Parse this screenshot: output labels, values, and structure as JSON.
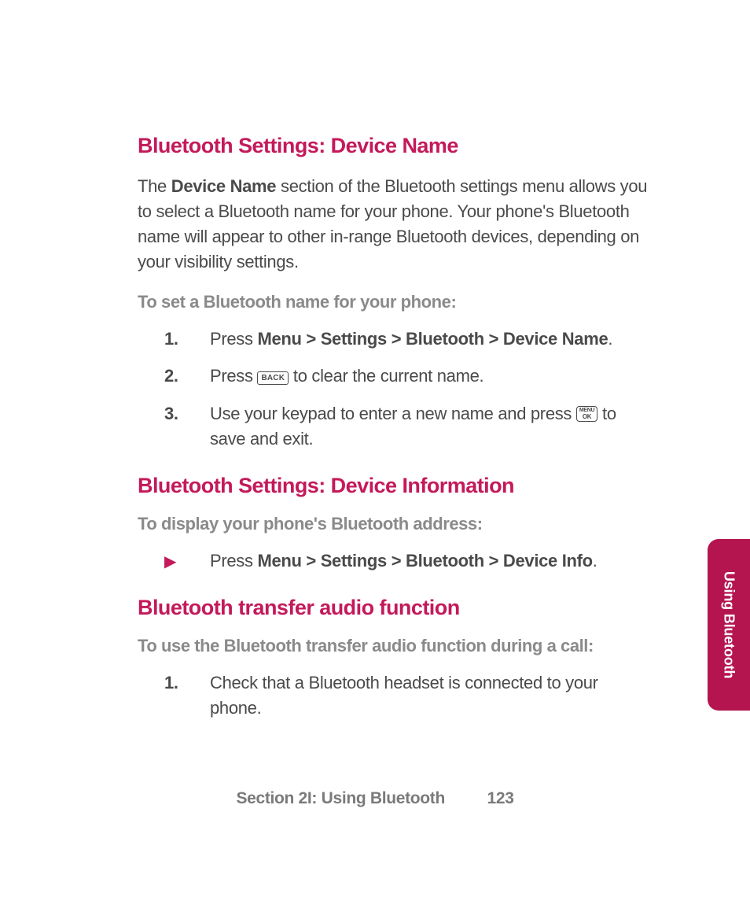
{
  "headings": {
    "h1": "Bluetooth Settings: Device Name",
    "h2": "Bluetooth Settings: Device Information",
    "h3": "Bluetooth transfer audio function"
  },
  "paras": {
    "intro_pre": "The ",
    "intro_bold": "Device Name",
    "intro_post": " section of the Bluetooth settings menu allows you to select a Bluetooth name for your phone. Your phone's Bluetooth name will appear to other in-range Bluetooth devices, depending on your visibility settings."
  },
  "subheads": {
    "s1": "To set a Bluetooth name for your phone:",
    "s2": "To display your phone's Bluetooth address:",
    "s3": "To use the Bluetooth transfer audio function during a call:"
  },
  "steps1": {
    "n1": "1.",
    "n2": "2.",
    "n3": "3.",
    "t1_pre": "Press ",
    "t1_bold": "Menu > Settings > Bluetooth > Device Name",
    "t1_post": ".",
    "t2_pre": "Press  ",
    "t2_post": "  to clear the current name.",
    "t3_pre": "Use your keypad to enter a new name and press  ",
    "t3_post": "  to save and exit."
  },
  "bullet1": {
    "pre": "Press ",
    "bold": "Menu > Settings > Bluetooth > Device Info",
    "post": "."
  },
  "steps2": {
    "n1": "1.",
    "t1": "Check that a Bluetooth headset is connected to your phone."
  },
  "keys": {
    "back": "BACK",
    "ok_l1": "MENU",
    "ok_l2": "OK"
  },
  "sidetab": "Using Bluetooth",
  "footer": {
    "section": "Section 2I: Using Bluetooth",
    "page": "123"
  }
}
